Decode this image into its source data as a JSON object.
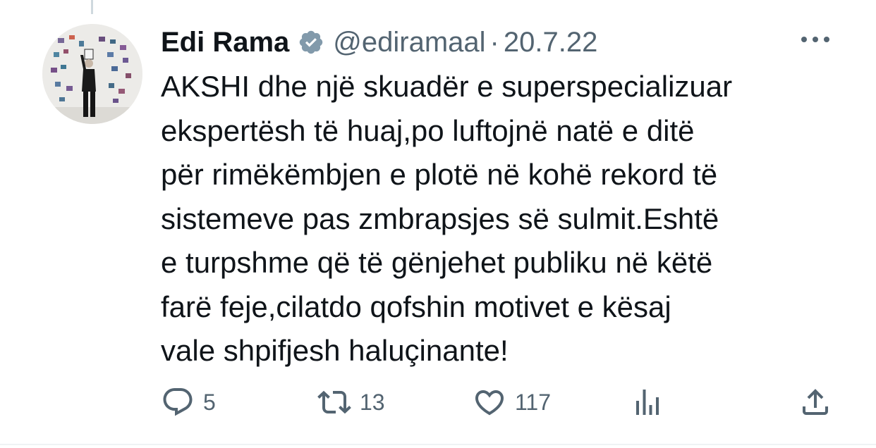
{
  "tweet": {
    "author_name": "Edi Rama",
    "handle": "@ediramaal",
    "separator": "·",
    "date": "20.7.22",
    "text_lines": [
      "AKSHI dhe një skuadër e superspecializuar",
      "ekspertësh të huaj,po luftojnë natë e ditë",
      "për rimëkëmbjen e plotë në kohë rekord të",
      "sistemeve pas zmbrapsjes së sulmit.Eshtë",
      "e turpshme që të gënjehet publiku në këtë",
      "farë feje,cilatdo qofshin motivet e kësaj",
      "vale shpifjesh haluçinante!"
    ]
  },
  "actions": {
    "reply_count": "5",
    "retweet_count": "13",
    "like_count": "117"
  },
  "icons": {
    "verified": "verified-badge-icon",
    "more": "more-options-icon",
    "reply": "reply-icon",
    "retweet": "retweet-icon",
    "like": "heart-icon",
    "views": "analytics-icon",
    "share": "share-icon"
  },
  "colors": {
    "text_primary": "#0f1419",
    "text_secondary": "#536471",
    "verified_badge": "#829aab",
    "divider": "#eff3f4"
  }
}
